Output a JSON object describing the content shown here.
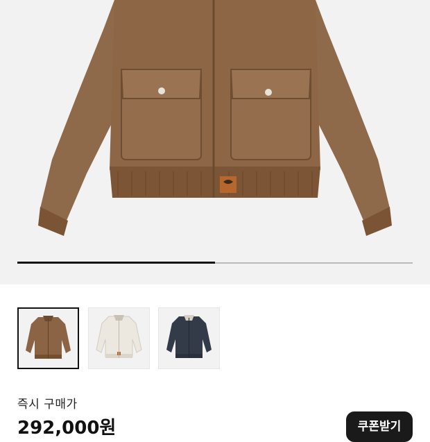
{
  "product_gallery": {
    "image_count_progress": 0.5,
    "main_image": "brown-canvas-bomber-jacket",
    "thumbnails": [
      {
        "color": "brown",
        "selected": true
      },
      {
        "color": "off-white",
        "selected": false
      },
      {
        "color": "navy",
        "selected": false
      }
    ]
  },
  "price": {
    "label": "즉시 구매가",
    "value": "292,000원"
  },
  "coupon": {
    "label": "쿠폰받기"
  },
  "colors": {
    "jacket_brown": "#8a6445",
    "jacket_white": "#ece8df",
    "jacket_navy": "#333a48",
    "button_bg": "#1a1a1a"
  }
}
